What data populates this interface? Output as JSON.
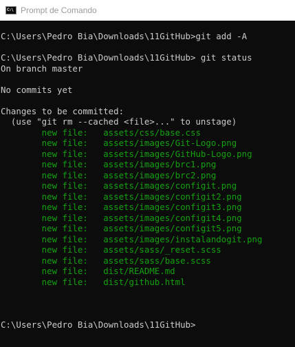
{
  "window": {
    "title": "Prompt de Comando",
    "icon": "cmd-icon",
    "icon_text": "C:\\",
    "colors": {
      "background": "#0c0c0c",
      "text": "#cccccc",
      "staged": "#13a10e",
      "titlebar": "#ffffff",
      "title_text": "#9b9b9b"
    }
  },
  "console": {
    "lines": [
      {
        "text": "C:\\Users\\Pedro Bia\\Downloads\\11GitHub>git add -A",
        "kind": "normal"
      },
      {
        "text": "",
        "kind": "normal"
      },
      {
        "text": "C:\\Users\\Pedro Bia\\Downloads\\11GitHub> git status",
        "kind": "normal"
      },
      {
        "text": "On branch master",
        "kind": "normal"
      },
      {
        "text": "",
        "kind": "normal"
      },
      {
        "text": "No commits yet",
        "kind": "normal"
      },
      {
        "text": "",
        "kind": "normal"
      },
      {
        "text": "Changes to be committed:",
        "kind": "normal"
      },
      {
        "text": "  (use \"git rm --cached <file>...\" to unstage)",
        "kind": "normal"
      },
      {
        "text": "        new file:   assets/css/base.css",
        "kind": "green"
      },
      {
        "text": "        new file:   assets/images/Git-Logo.png",
        "kind": "green"
      },
      {
        "text": "        new file:   assets/images/GitHub-Logo.png",
        "kind": "green"
      },
      {
        "text": "        new file:   assets/images/brc1.png",
        "kind": "green"
      },
      {
        "text": "        new file:   assets/images/brc2.png",
        "kind": "green"
      },
      {
        "text": "        new file:   assets/images/configit.png",
        "kind": "green"
      },
      {
        "text": "        new file:   assets/images/configit2.png",
        "kind": "green"
      },
      {
        "text": "        new file:   assets/images/configit3.png",
        "kind": "green"
      },
      {
        "text": "        new file:   assets/images/configit4.png",
        "kind": "green"
      },
      {
        "text": "        new file:   assets/images/configit5.png",
        "kind": "green"
      },
      {
        "text": "        new file:   assets/images/instalandogit.png",
        "kind": "green"
      },
      {
        "text": "        new file:   assets/sass/_reset.scss",
        "kind": "green"
      },
      {
        "text": "        new file:   assets/sass/base.scss",
        "kind": "green"
      },
      {
        "text": "        new file:   dist/README.md",
        "kind": "green"
      },
      {
        "text": "        new file:   dist/github.html",
        "kind": "green"
      },
      {
        "text": "",
        "kind": "normal"
      },
      {
        "text": "",
        "kind": "normal"
      },
      {
        "text": "",
        "kind": "normal"
      },
      {
        "text": "C:\\Users\\Pedro Bia\\Downloads\\11GitHub>",
        "kind": "normal"
      }
    ]
  }
}
